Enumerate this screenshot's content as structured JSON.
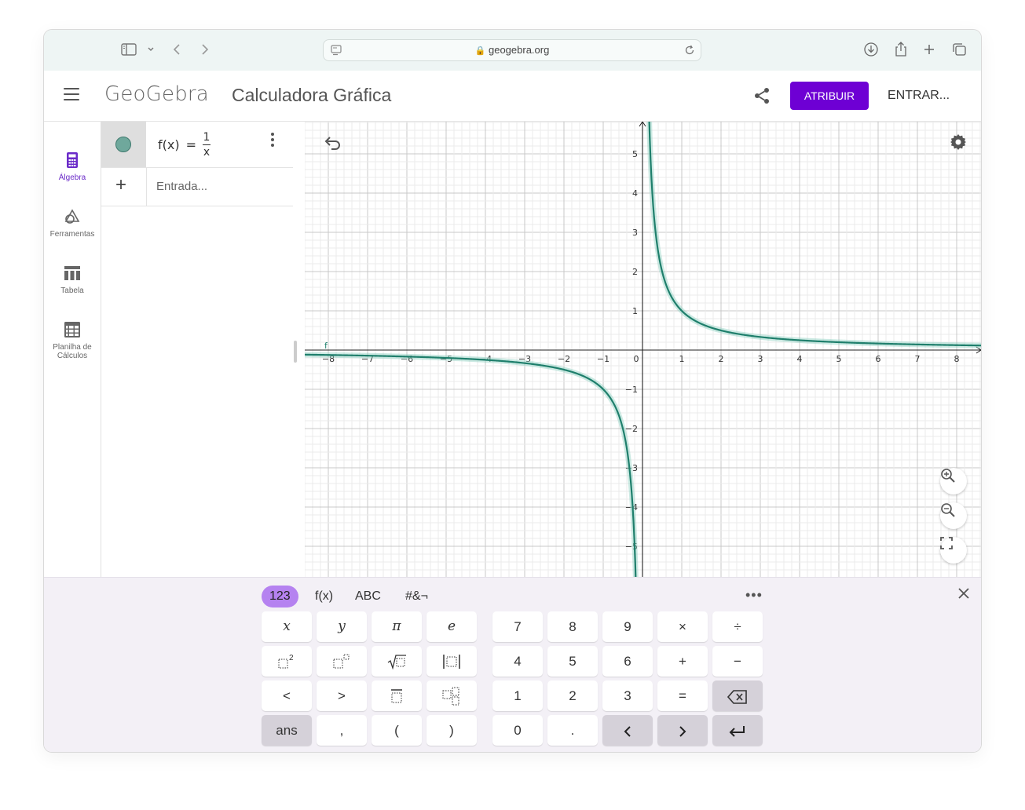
{
  "browser": {
    "url": "geogebra.org"
  },
  "header": {
    "logo": "GeoGebra",
    "title": "Calculadora Gráfica",
    "assign_label": "ATRIBUIR",
    "login_label": "ENTRAR..."
  },
  "sidenav": {
    "items": [
      {
        "label": "Álgebra",
        "icon": "calculator-icon",
        "active": true
      },
      {
        "label": "Ferramentas",
        "icon": "tools-icon",
        "active": false
      },
      {
        "label": "Tabela",
        "icon": "table-icon",
        "active": false
      },
      {
        "label": "Planilha de Cálculos",
        "icon": "spreadsheet-icon",
        "active": false
      }
    ]
  },
  "algebra": {
    "expression": {
      "name": "f(x)",
      "equals": "=",
      "numerator": "1",
      "denominator": "x",
      "color": "#2b8a7a"
    },
    "input_placeholder": "Entrada..."
  },
  "graph": {
    "function": "1/x",
    "curve_label": "f",
    "curve_color": "#1f7f6c",
    "x_ticks": [
      "-8",
      "-7",
      "-6",
      "-5",
      "-4",
      "-3",
      "-2",
      "-1",
      "0",
      "1",
      "2",
      "3",
      "4",
      "5",
      "6",
      "7",
      "8"
    ],
    "y_ticks": [
      "5",
      "4",
      "3",
      "2",
      "1",
      "-1",
      "-2",
      "-3",
      "-4",
      "-5"
    ],
    "xlim": [
      -8.6,
      8.6
    ],
    "ylim": [
      -5.8,
      5.8
    ],
    "grid": true
  },
  "keyboard": {
    "tabs": [
      "123",
      "f(x)",
      "ABC",
      "#&¬"
    ],
    "active_tab": "123",
    "more": "•••",
    "left_keys": [
      [
        "x",
        "y",
        "π",
        "e"
      ],
      [
        "□²",
        "□ⁿ",
        "√□",
        "|□|"
      ],
      [
        "<",
        ">",
        "□̅",
        "□ₙ"
      ],
      [
        "ans",
        ",",
        "(",
        ")"
      ]
    ],
    "right_keys": [
      [
        "7",
        "8",
        "9",
        "×",
        "÷"
      ],
      [
        "4",
        "5",
        "6",
        "+",
        "−"
      ],
      [
        "1",
        "2",
        "3",
        "=",
        "⌫"
      ],
      [
        "0",
        ".",
        "<",
        ">",
        "↵"
      ]
    ]
  },
  "colors": {
    "accent": "#6e00d4",
    "keyboard_tab_active": "#b582f0"
  }
}
